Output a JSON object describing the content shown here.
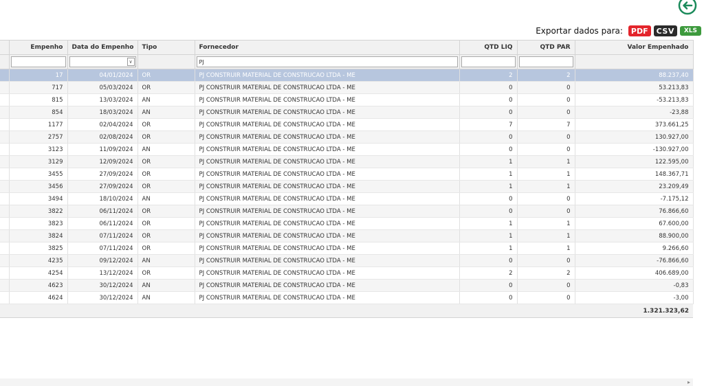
{
  "export": {
    "label": "Exportar dados para:",
    "pdf": "PDF",
    "csv": "CSV",
    "xls": "XLS"
  },
  "back_icon": "arrow-left-circle-icon",
  "colors": {
    "selected_row": "#b7c6de",
    "pdf": "#e3242b",
    "csv": "#2b2b2b",
    "xls": "#3d9a3d",
    "back_icon": "#1a8a5a"
  },
  "columns": [
    "Empenho",
    "Data do Empenho",
    "Tipo",
    "Fornecedor",
    "QTD LIQ",
    "QTD PAR",
    "Valor Empenhado"
  ],
  "filters": {
    "empenho": "",
    "data": "",
    "fornecedor": "PJ",
    "qtd_liq": "",
    "qtd_par": ""
  },
  "rows": [
    {
      "empenho": "17",
      "data": "04/01/2024",
      "tipo": "OR",
      "fornecedor": "PJ CONSTRUIR MATERIAL DE CONSTRUCAO LTDA - ME",
      "qtd_liq": "2",
      "qtd_par": "2",
      "valor": "88.237,40"
    },
    {
      "empenho": "717",
      "data": "05/03/2024",
      "tipo": "OR",
      "fornecedor": "PJ CONSTRUIR MATERIAL DE CONSTRUCAO LTDA - ME",
      "qtd_liq": "0",
      "qtd_par": "0",
      "valor": "53.213,83"
    },
    {
      "empenho": "815",
      "data": "13/03/2024",
      "tipo": "AN",
      "fornecedor": "PJ CONSTRUIR MATERIAL DE CONSTRUCAO LTDA - ME",
      "qtd_liq": "0",
      "qtd_par": "0",
      "valor": "-53.213,83"
    },
    {
      "empenho": "854",
      "data": "18/03/2024",
      "tipo": "AN",
      "fornecedor": "PJ CONSTRUIR MATERIAL DE CONSTRUCAO LTDA - ME",
      "qtd_liq": "0",
      "qtd_par": "0",
      "valor": "-23,88"
    },
    {
      "empenho": "1177",
      "data": "02/04/2024",
      "tipo": "OR",
      "fornecedor": "PJ CONSTRUIR MATERIAL DE CONSTRUCAO LTDA - ME",
      "qtd_liq": "7",
      "qtd_par": "7",
      "valor": "373.661,25"
    },
    {
      "empenho": "2757",
      "data": "02/08/2024",
      "tipo": "OR",
      "fornecedor": "PJ CONSTRUIR MATERIAL DE CONSTRUCAO LTDA - ME",
      "qtd_liq": "0",
      "qtd_par": "0",
      "valor": "130.927,00"
    },
    {
      "empenho": "3123",
      "data": "11/09/2024",
      "tipo": "AN",
      "fornecedor": "PJ CONSTRUIR MATERIAL DE CONSTRUCAO LTDA - ME",
      "qtd_liq": "0",
      "qtd_par": "0",
      "valor": "-130.927,00"
    },
    {
      "empenho": "3129",
      "data": "12/09/2024",
      "tipo": "OR",
      "fornecedor": "PJ CONSTRUIR MATERIAL DE CONSTRUCAO LTDA - ME",
      "qtd_liq": "1",
      "qtd_par": "1",
      "valor": "122.595,00"
    },
    {
      "empenho": "3455",
      "data": "27/09/2024",
      "tipo": "OR",
      "fornecedor": "PJ CONSTRUIR MATERIAL DE CONSTRUCAO LTDA - ME",
      "qtd_liq": "1",
      "qtd_par": "1",
      "valor": "148.367,71"
    },
    {
      "empenho": "3456",
      "data": "27/09/2024",
      "tipo": "OR",
      "fornecedor": "PJ CONSTRUIR MATERIAL DE CONSTRUCAO LTDA - ME",
      "qtd_liq": "1",
      "qtd_par": "1",
      "valor": "23.209,49"
    },
    {
      "empenho": "3494",
      "data": "18/10/2024",
      "tipo": "AN",
      "fornecedor": "PJ CONSTRUIR MATERIAL DE CONSTRUCAO LTDA - ME",
      "qtd_liq": "0",
      "qtd_par": "0",
      "valor": "-7.175,12"
    },
    {
      "empenho": "3822",
      "data": "06/11/2024",
      "tipo": "OR",
      "fornecedor": "PJ CONSTRUIR MATERIAL DE CONSTRUCAO LTDA - ME",
      "qtd_liq": "0",
      "qtd_par": "0",
      "valor": "76.866,60"
    },
    {
      "empenho": "3823",
      "data": "06/11/2024",
      "tipo": "OR",
      "fornecedor": "PJ CONSTRUIR MATERIAL DE CONSTRUCAO LTDA - ME",
      "qtd_liq": "1",
      "qtd_par": "1",
      "valor": "67.600,00"
    },
    {
      "empenho": "3824",
      "data": "07/11/2024",
      "tipo": "OR",
      "fornecedor": "PJ CONSTRUIR MATERIAL DE CONSTRUCAO LTDA - ME",
      "qtd_liq": "1",
      "qtd_par": "1",
      "valor": "88.900,00"
    },
    {
      "empenho": "3825",
      "data": "07/11/2024",
      "tipo": "OR",
      "fornecedor": "PJ CONSTRUIR MATERIAL DE CONSTRUCAO LTDA - ME",
      "qtd_liq": "1",
      "qtd_par": "1",
      "valor": "9.266,60"
    },
    {
      "empenho": "4235",
      "data": "09/12/2024",
      "tipo": "AN",
      "fornecedor": "PJ CONSTRUIR MATERIAL DE CONSTRUCAO LTDA - ME",
      "qtd_liq": "0",
      "qtd_par": "0",
      "valor": "-76.866,60"
    },
    {
      "empenho": "4254",
      "data": "13/12/2024",
      "tipo": "OR",
      "fornecedor": "PJ CONSTRUIR MATERIAL DE CONSTRUCAO LTDA - ME",
      "qtd_liq": "2",
      "qtd_par": "2",
      "valor": "406.689,00"
    },
    {
      "empenho": "4623",
      "data": "30/12/2024",
      "tipo": "AN",
      "fornecedor": "PJ CONSTRUIR MATERIAL DE CONSTRUCAO LTDA - ME",
      "qtd_liq": "0",
      "qtd_par": "0",
      "valor": "-0,83"
    },
    {
      "empenho": "4624",
      "data": "30/12/2024",
      "tipo": "AN",
      "fornecedor": "PJ CONSTRUIR MATERIAL DE CONSTRUCAO LTDA - ME",
      "qtd_liq": "0",
      "qtd_par": "0",
      "valor": "-3,00"
    }
  ],
  "selected_row_index": 0,
  "total": "1.321.323,62"
}
